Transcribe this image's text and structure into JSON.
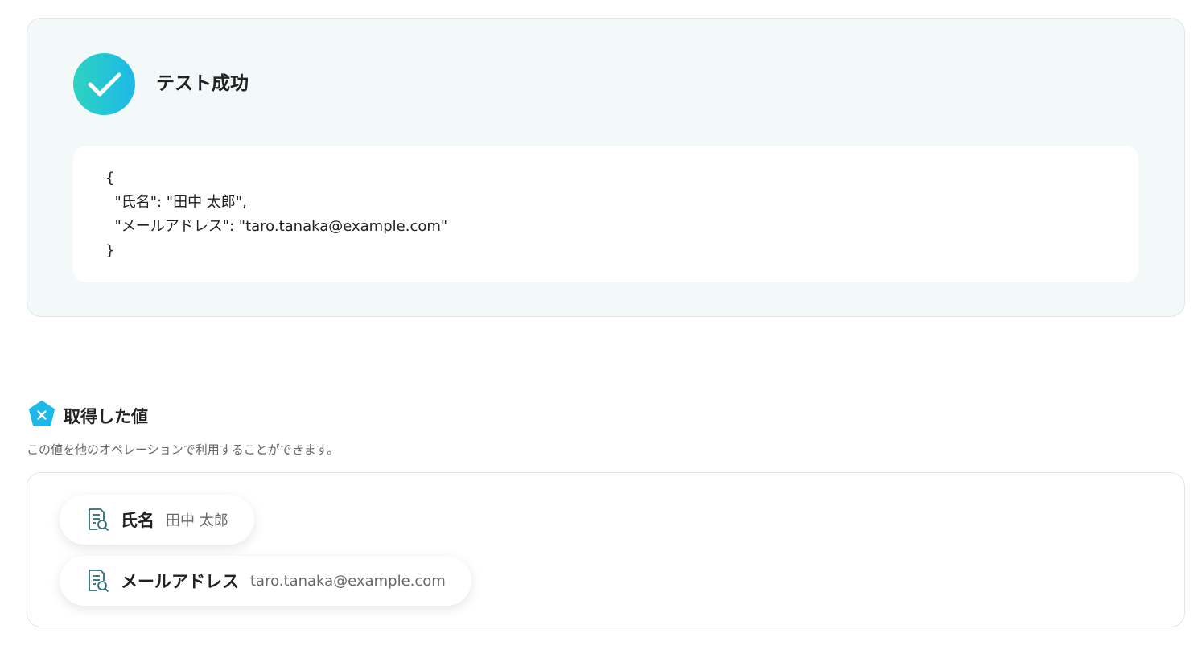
{
  "test_result": {
    "title": "テスト成功",
    "json_output": "{\n  \"氏名\": \"田中 太郎\",\n  \"メールアドレス\": \"taro.tanaka@example.com\"\n}"
  },
  "acquired_values": {
    "title": "取得した値",
    "description": "この値を他のオペレーションで利用することができます。",
    "items": [
      {
        "label": "氏名",
        "value": "田中 太郎"
      },
      {
        "label": "メールアドレス",
        "value": "taro.tanaka@example.com"
      }
    ]
  },
  "icons": {
    "success": "checkmark-icon",
    "variable": "variable-icon",
    "item": "document-search-icon"
  },
  "colors": {
    "accent_start": "#2ed3c0",
    "accent_end": "#1cb8e8",
    "variable_icon": "#1cb8e8",
    "item_icon": "#2b6f7a"
  }
}
